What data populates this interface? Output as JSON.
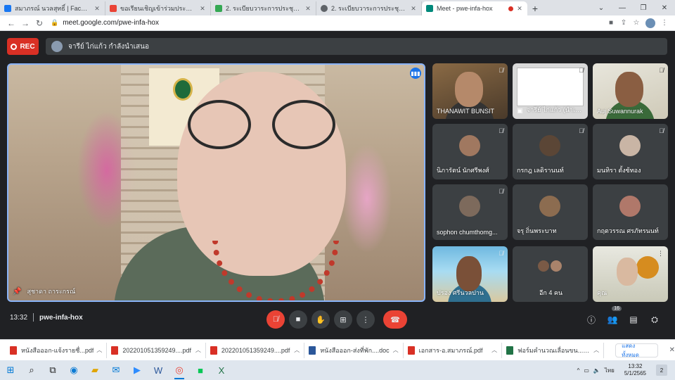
{
  "browser": {
    "tabs": [
      {
        "label": "สมาภรณ์ นวลสุทธิ์ | Facebook",
        "fav_color": "#1877f2"
      },
      {
        "label": "ขอเรียนเชิญเข้าร่วมประชุมคณะกรรมการ",
        "fav_color": "#ea4335"
      },
      {
        "label": "2. ระเบียบวาระการประชุมคณะกรรมการ",
        "fav_color": "#34a853"
      },
      {
        "label": "2. ระเบียบวาระการประชุมคณะกรรมการ",
        "fav_color": "#5f6368"
      },
      {
        "label": "Meet - pwe-infa-hox",
        "fav_color": "#00897b"
      }
    ],
    "new_tab": "+",
    "url": "meet.google.com/pwe-infa-hox"
  },
  "meet": {
    "rec_label": "REC",
    "presenter_text": "จารีย์ ไก่แก้ว กำลังนำเสนอ",
    "main_speaker": "สุชาดา ถาระกรณ์",
    "participants": [
      {
        "name": "THANAWIT BUNSIT",
        "kind": "video"
      },
      {
        "name": "จารีย์ ไก่แก้ว (นำเสนอ)",
        "kind": "screen"
      },
      {
        "name": "Auj Suwannurak",
        "kind": "video"
      },
      {
        "name": "นิภารัตน์ นักศรีพงศ์",
        "kind": "avatar"
      },
      {
        "name": "กรกฎ เลดิรานนท์",
        "kind": "avatar"
      },
      {
        "name": "มนทิรา ตั้งซ้ทอง",
        "kind": "avatar"
      },
      {
        "name": "sophon chumthomg...",
        "kind": "avatar"
      },
      {
        "name": "จรุ ถิ่นพระบาท",
        "kind": "avatar"
      },
      {
        "name": "กฤตวรรณ ศรภัทรนนท์",
        "kind": "avatar"
      },
      {
        "name": "ปรอง ศรีนวลปาน",
        "kind": "beach"
      },
      {
        "name": "อีก 4 คน",
        "kind": "more"
      },
      {
        "name": "คุณ",
        "kind": "office"
      }
    ],
    "time": "13:32",
    "meeting_code": "pwe-infa-hox",
    "participant_count": "16"
  },
  "downloads": [
    {
      "name": "หนังสือออก-แจ้งรายชื่...pdf",
      "color": "#d93025"
    },
    {
      "name": "202201051359249....pdf",
      "color": "#d93025"
    },
    {
      "name": "202201051359249....pdf",
      "color": "#d93025"
    },
    {
      "name": "หนังสือออก-ส่งที่พัก....doc",
      "color": "#2b579a"
    },
    {
      "name": "เอกสาร-อ.สมาภรณ์.pdf",
      "color": "#d93025"
    },
    {
      "name": "ฟอร์มคำนวณเลื่อนขน....xlsx",
      "color": "#217346"
    }
  ],
  "downloads_show_all": "แสดงทั้งหมด",
  "taskbar": {
    "lang": "ไทย",
    "time": "13:32",
    "date": "5/1/2565",
    "notif_count": "2"
  }
}
